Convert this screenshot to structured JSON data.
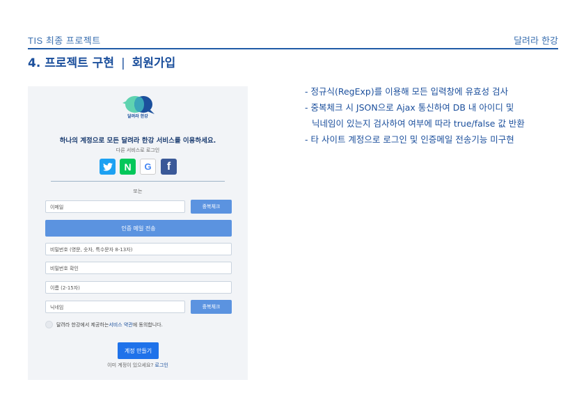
{
  "header": {
    "project": "TIS 최종 프로젝트",
    "team": "달려라 한강"
  },
  "section": {
    "title": "4. 프로젝트 구현",
    "separator": "|",
    "subtitle": "회원가입"
  },
  "screenshot": {
    "logo_text": "달려라 한강",
    "intro": "하나의 계정으로 모든 달려라 한강 서비스를 이용하세요.",
    "social_label": "다른 서비스로 로그인",
    "social": [
      {
        "name": "twitter",
        "glyph": "🐦",
        "color": "#1da1f2"
      },
      {
        "name": "naver",
        "glyph": "N",
        "color": "#03c75a"
      },
      {
        "name": "google",
        "glyph": "G",
        "color": "#4285f4"
      },
      {
        "name": "facebook",
        "glyph": "f",
        "color": "#3b5998"
      }
    ],
    "or_label": "또는",
    "email_placeholder": "이메일",
    "dup_check_label": "중복체크",
    "send_verification_label": "인증 메일 전송",
    "password_placeholder": "비밀번호 (영문, 숫자, 특수문자 8-13자)",
    "password_confirm_placeholder": "비밀번호 확인",
    "name_placeholder": "이름 (2-15자)",
    "nickname_placeholder": "닉네임",
    "nickname_check_label": "중복체크",
    "agree_prefix": "달려라 한강에서 제공하는 ",
    "agree_link": "서비스 약관",
    "agree_suffix": "에 동의합니다.",
    "create_label": "계정 만들기",
    "login_question": "이미 계정이 있으세요? ",
    "login_link": "로그인"
  },
  "notes": [
    "- 정규식(RegExp)를 이용해 모든 입력창에 유효성 검사",
    "- 중복체크 시 JSON으로 Ajax 통신하여 DB 내 아이디 및",
    "닉네임이 있는지 검사하여 여부에 따라 true/false 값 반환",
    "- 타 사이트 계정으로 로그인 및 인증메일 전송기능 미구현"
  ],
  "colors": {
    "accent": "#1b4f9c",
    "button": "#5b93e0",
    "create_button": "#1f72ea"
  }
}
